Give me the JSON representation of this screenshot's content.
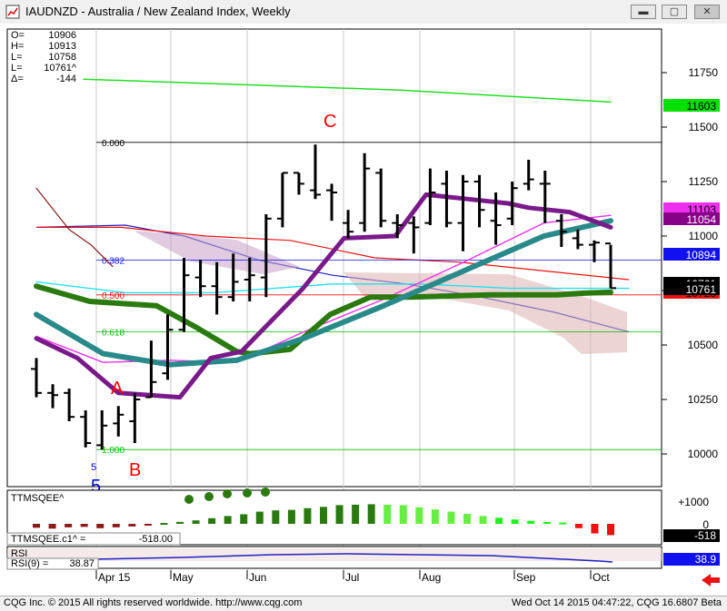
{
  "window": {
    "title": "IAUDNZD - Australia / New Zealand Index, Weekly",
    "min": "▬",
    "max": "▢",
    "close": "✕"
  },
  "status": {
    "left": "CQG Inc. © 2015 All rights reserved worldwide. http://www.cqg.com",
    "right": "Wed Oct 14 2015 04:47:22, CQG 16.6807 Beta"
  },
  "chart_data": {
    "type": "candlestick",
    "title": "IAUDNZD - Australia / New Zealand Index, Weekly",
    "ohlc_box": [
      {
        "k": "O=",
        "v": "10906"
      },
      {
        "k": "H=",
        "v": "10913"
      },
      {
        "k": "L=",
        "v": "10758"
      },
      {
        "k": "L=",
        "v": "10761^"
      },
      {
        "k": "Δ=",
        "v": "-144"
      }
    ],
    "y_axis": {
      "ticks": [
        "11750",
        "11500",
        "11250",
        "11000",
        "10750",
        "10500",
        "10250",
        "10000"
      ],
      "ylim": [
        9850,
        12000
      ]
    },
    "x_axis": {
      "labels": [
        "Apr 15",
        "May",
        "Jun",
        "Jul",
        "Aug",
        "Sep",
        "Oct"
      ]
    },
    "bars": [
      {
        "o": 10390,
        "h": 10440,
        "l": 10260,
        "c": 10280
      },
      {
        "o": 10280,
        "h": 10320,
        "l": 10210,
        "c": 10270
      },
      {
        "o": 10280,
        "h": 10300,
        "l": 10150,
        "c": 10170
      },
      {
        "o": 10170,
        "h": 10200,
        "l": 10030,
        "c": 10050
      },
      {
        "o": 10040,
        "h": 10200,
        "l": 10020,
        "c": 10130
      },
      {
        "o": 10140,
        "h": 10220,
        "l": 10080,
        "c": 10180
      },
      {
        "o": 10150,
        "h": 10280,
        "l": 10050,
        "c": 10250
      },
      {
        "o": 10260,
        "h": 10520,
        "l": 10260,
        "c": 10330
      },
      {
        "o": 10370,
        "h": 10640,
        "l": 10340,
        "c": 10570
      },
      {
        "o": 10570,
        "h": 10900,
        "l": 10560,
        "c": 10820
      },
      {
        "o": 10810,
        "h": 10890,
        "l": 10720,
        "c": 10770
      },
      {
        "o": 10770,
        "h": 10880,
        "l": 10640,
        "c": 10720
      },
      {
        "o": 10720,
        "h": 10920,
        "l": 10700,
        "c": 10790
      },
      {
        "o": 10800,
        "h": 10900,
        "l": 10700,
        "c": 10820
      },
      {
        "o": 10810,
        "h": 11100,
        "l": 10720,
        "c": 11080
      },
      {
        "o": 11080,
        "h": 11290,
        "l": 11040,
        "c": 11290
      },
      {
        "o": 11290,
        "h": 11290,
        "l": 11190,
        "c": 11240
      },
      {
        "o": 11210,
        "h": 11420,
        "l": 11170,
        "c": 11190
      },
      {
        "o": 11210,
        "h": 11240,
        "l": 11070,
        "c": 11200
      },
      {
        "o": 11060,
        "h": 11120,
        "l": 10990,
        "c": 11020
      },
      {
        "o": 11060,
        "h": 11380,
        "l": 11020,
        "c": 11310
      },
      {
        "o": 11290,
        "h": 11310,
        "l": 11040,
        "c": 11070
      },
      {
        "o": 11060,
        "h": 11100,
        "l": 10990,
        "c": 11050
      },
      {
        "o": 11060,
        "h": 11090,
        "l": 10920,
        "c": 11040
      },
      {
        "o": 11060,
        "h": 11310,
        "l": 11050,
        "c": 11200
      },
      {
        "o": 11240,
        "h": 11300,
        "l": 11040,
        "c": 11060
      },
      {
        "o": 11060,
        "h": 11280,
        "l": 10930,
        "c": 11250
      },
      {
        "o": 11250,
        "h": 11280,
        "l": 11040,
        "c": 11120
      },
      {
        "o": 11070,
        "h": 11200,
        "l": 10960,
        "c": 11050
      },
      {
        "o": 11080,
        "h": 11250,
        "l": 11050,
        "c": 11220
      },
      {
        "o": 11240,
        "h": 11350,
        "l": 11210,
        "c": 11260
      },
      {
        "o": 11240,
        "h": 11300,
        "l": 11060,
        "c": 11240
      },
      {
        "o": 11070,
        "h": 11100,
        "l": 10950,
        "c": 11020
      },
      {
        "o": 10990,
        "h": 11030,
        "l": 10940,
        "c": 10960
      },
      {
        "o": 10960,
        "h": 10980,
        "l": 10880,
        "c": 10970
      },
      {
        "o": 10966,
        "h": 10960,
        "l": 10760,
        "c": 10761
      }
    ],
    "lines": {
      "green_top": [
        [
          0,
          11720
        ],
        [
          12,
          11670
        ],
        [
          20,
          11615
        ]
      ],
      "dark_green_ma": [
        [
          0,
          10770
        ],
        [
          4,
          10700
        ],
        [
          9,
          10680
        ],
        [
          12,
          10580
        ],
        [
          15,
          10470
        ],
        [
          16,
          10460
        ],
        [
          19,
          10480
        ],
        [
          22,
          10640
        ],
        [
          25,
          10720
        ],
        [
          28,
          10720
        ],
        [
          34,
          10730
        ],
        [
          39,
          10730
        ],
        [
          41,
          10738
        ],
        [
          43,
          10742
        ]
      ],
      "teal_ma": [
        [
          0,
          10640
        ],
        [
          5,
          10460
        ],
        [
          10,
          10410
        ],
        [
          15,
          10430
        ],
        [
          20,
          10530
        ],
        [
          26,
          10680
        ],
        [
          32,
          10840
        ],
        [
          38,
          11000
        ],
        [
          43,
          11070
        ]
      ],
      "magenta_ma": [
        [
          0,
          10540
        ],
        [
          5,
          10420
        ],
        [
          10,
          10430
        ],
        [
          15,
          10420
        ],
        [
          20,
          10560
        ],
        [
          26,
          10710
        ],
        [
          32,
          10880
        ],
        [
          38,
          11060
        ],
        [
          43,
          11095
        ]
      ],
      "purple_ma": [
        [
          0,
          10530
        ],
        [
          4,
          10440
        ],
        [
          8,
          10280
        ],
        [
          14,
          10260
        ],
        [
          17,
          10440
        ],
        [
          20,
          10470
        ],
        [
          26,
          10760
        ],
        [
          30,
          10990
        ],
        [
          35,
          11000
        ],
        [
          38,
          11190
        ],
        [
          42,
          11170
        ],
        [
          46,
          11150
        ],
        [
          48,
          11130
        ],
        [
          52,
          11110
        ],
        [
          56,
          11040
        ]
      ],
      "cyan_ma": [
        [
          0,
          10790
        ],
        [
          6,
          10740
        ],
        [
          12,
          10740
        ],
        [
          20,
          10780
        ],
        [
          26,
          10780
        ],
        [
          32,
          10760
        ],
        [
          40,
          10760
        ]
      ],
      "brown_line": [
        [
          0,
          11220
        ],
        [
          3,
          11030
        ],
        [
          5,
          10960
        ],
        [
          7,
          10860
        ]
      ],
      "red_cloud_top": [
        [
          0,
          11040
        ],
        [
          10,
          11040
        ],
        [
          20,
          11000
        ],
        [
          30,
          10980
        ],
        [
          40,
          10900
        ],
        [
          50,
          10880
        ],
        [
          60,
          10840
        ],
        [
          70,
          10800
        ]
      ],
      "blue_cloud": [
        [
          0,
          11040
        ],
        [
          12,
          11050
        ],
        [
          20,
          11000
        ],
        [
          30,
          10890
        ],
        [
          40,
          10820
        ],
        [
          50,
          10780
        ],
        [
          60,
          10720
        ],
        [
          70,
          10650
        ],
        [
          80,
          10560
        ]
      ]
    },
    "fib_levels": [
      {
        "label": "0.000",
        "value": 11430
      },
      {
        "label": "0.382",
        "value": 10890
      },
      {
        "label": "0.500",
        "value": 10730
      },
      {
        "label": "0.618",
        "value": 10560
      },
      {
        "label": "1.000",
        "value": 10020
      }
    ],
    "price_tags": [
      {
        "value": "11603",
        "color": "#00e000",
        "text_color": "#000000"
      },
      {
        "value": "11103",
        "color": "#ee30ee",
        "text_color": "#000000"
      },
      {
        "value": "11054",
        "color": "#880088",
        "text_color": "#ffffff"
      },
      {
        "value": "10894",
        "color": "#1010f0",
        "text_color": "#ffffff"
      },
      {
        "value": "10761",
        "color": "#000000",
        "text_color": "#ffffff"
      },
      {
        "value": "10728",
        "color": "#ee1111",
        "text_color": "#000000"
      }
    ],
    "annotations": [
      {
        "text": "C",
        "color": "#ff0000"
      },
      {
        "text": "A",
        "color": "#ff0000"
      },
      {
        "text": "B",
        "color": "#ff0000"
      },
      {
        "text": "5",
        "color": "#0000cc"
      },
      {
        "text": "5",
        "color": "#0000cc"
      }
    ],
    "ttm_panel": {
      "label": "TTMSQEE^",
      "readout_label": "TTMSQEE.c1^ =",
      "readout_value": "-518.00",
      "ticks": [
        "+1000",
        "0"
      ],
      "value_tag": "-518",
      "histogram": [
        -180,
        -220,
        -160,
        -140,
        -200,
        -160,
        -120,
        -40,
        40,
        90,
        160,
        260,
        360,
        440,
        560,
        620,
        640,
        720,
        780,
        860,
        880,
        900,
        880,
        860,
        760,
        660,
        560,
        460,
        360,
        280,
        200,
        140,
        90,
        60,
        -200,
        -440,
        -520
      ]
    },
    "rsi_panel": {
      "label": "RSI",
      "readout_label": "RSI(9) =",
      "readout_value": "38.87",
      "value_tag": "38.9"
    }
  }
}
